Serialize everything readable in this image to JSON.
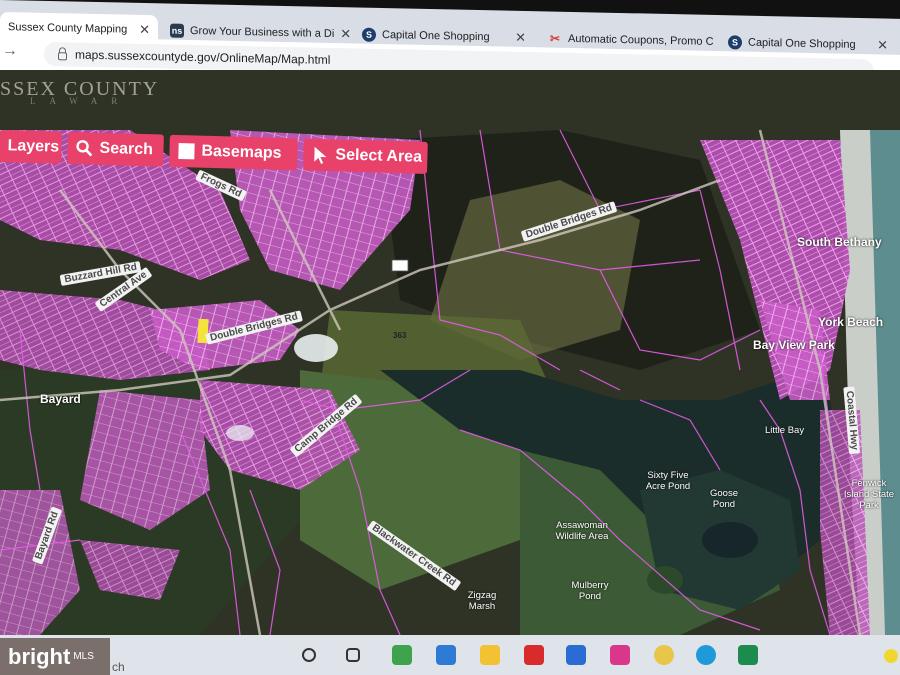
{
  "browser": {
    "tabs": [
      {
        "label": "Sussex County Mapping",
        "icon": "sussex-favicon",
        "color": "#7b4bd1"
      },
      {
        "label": "Grow Your Business with a Di",
        "icon": "ns-favicon",
        "color": "#2b3a4f",
        "letter": "ns"
      },
      {
        "label": "Capital One Shopping",
        "icon": "capital-one-favicon",
        "color": "#1f3d6b",
        "letter": "S"
      },
      {
        "label": "Automatic Coupons, Promo C",
        "icon": "coupon-favicon",
        "color": "#d63b3b",
        "letter": "✂"
      },
      {
        "label": "Capital One Shopping",
        "icon": "capital-one-favicon",
        "color": "#1f3d6b",
        "letter": "S"
      }
    ],
    "url": "maps.sussexcountyde.gov/OnlineMap/Map.html"
  },
  "app": {
    "brand": "SSEX COUNTY",
    "brand_sub": "LAWAR",
    "toolbar": {
      "layers": "Layers",
      "search": "Search",
      "basemaps": "Basemaps",
      "select_area": "Select Area"
    }
  },
  "map": {
    "places": [
      {
        "name": "Bayard",
        "kind": "place"
      },
      {
        "name": "South Bethany",
        "kind": "place"
      },
      {
        "name": "York Beach",
        "kind": "place"
      },
      {
        "name": "Bay View Park",
        "kind": "place"
      }
    ],
    "water": [
      "Little Bay",
      "Sixty Five Acre Pond",
      "Goose Pond",
      "Assawoman Wildlife Area",
      "Mulberry Pond",
      "Zigzag Marsh",
      "Fenwick Island State Park"
    ],
    "roads": [
      "Double Bridges Rd",
      "Double Bridges Rd",
      "Central Ave",
      "Camp Bridge Rd",
      "Blackwater Creek Rd",
      "Bayard Rd",
      "Frogs Rd",
      "Buzzard Hill Rd",
      "Coastal Hwy"
    ],
    "route_shield": "363"
  },
  "taskbar": {
    "watermark": "bright",
    "watermark_small": "MLS",
    "search_fragment": "ch"
  },
  "colors": {
    "parcel_line": "#e35ce6",
    "toolbar_button": "#e8416a",
    "water": "#1b2d2a"
  }
}
